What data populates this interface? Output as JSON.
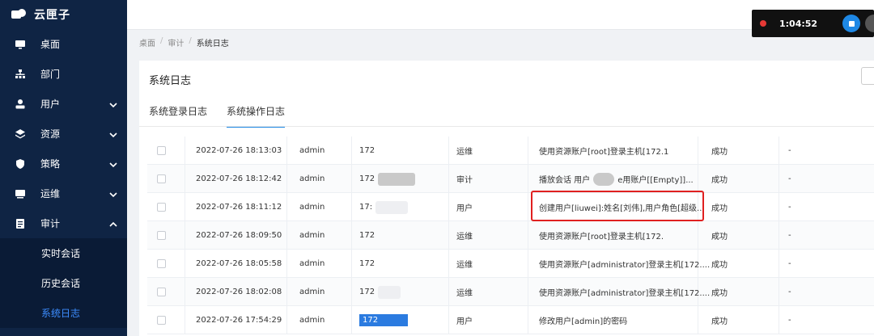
{
  "app": {
    "brand": "云匣子"
  },
  "recorder": {
    "time": "1:04:52"
  },
  "sidebar": {
    "items": [
      {
        "label": "桌面",
        "icon": "desktop-icon",
        "expandable": false
      },
      {
        "label": "部门",
        "icon": "org-icon",
        "expandable": false
      },
      {
        "label": "用户",
        "icon": "user-icon",
        "expandable": true
      },
      {
        "label": "资源",
        "icon": "resource-icon",
        "expandable": true
      },
      {
        "label": "策略",
        "icon": "shield-icon",
        "expandable": true
      },
      {
        "label": "运维",
        "icon": "ops-icon",
        "expandable": true
      },
      {
        "label": "审计",
        "icon": "audit-icon",
        "expandable": true,
        "expanded": true
      }
    ],
    "sub_items": [
      {
        "label": "实时会话"
      },
      {
        "label": "历史会话"
      },
      {
        "label": "系统日志",
        "active": true
      }
    ]
  },
  "breadcrumb": {
    "items": [
      "桌面",
      "审计",
      "系统日志"
    ],
    "sep": "/"
  },
  "card": {
    "title": "系统日志",
    "tabs": [
      {
        "label": "系统登录日志",
        "active": false
      },
      {
        "label": "系统操作日志",
        "active": true
      }
    ]
  },
  "table": {
    "rows": [
      {
        "time": "2022-07-26 18:13:03",
        "user": "admin",
        "ip": "172",
        "type": "运维",
        "desc": "使用资源账户[root]登录主机[172.1",
        "desc_tail": ".",
        "result": "成功",
        "extra": "-"
      },
      {
        "time": "2022-07-26 18:12:42",
        "user": "admin",
        "ip": "172",
        "type": "审计",
        "desc": "播放会话 用户",
        "desc_tail": "e用账户[[Empty]]...",
        "result": "成功",
        "extra": "-"
      },
      {
        "time": "2022-07-26 18:11:12",
        "user": "admin",
        "ip": "17:",
        "type": "用户",
        "desc": "创建用户[liuwei]:姓名[刘伟],用户角色[超级...",
        "desc_tail": "",
        "result": "成功",
        "extra": "-"
      },
      {
        "time": "2022-07-26 18:09:50",
        "user": "admin",
        "ip": "172",
        "type": "运维",
        "desc": "使用资源账户[root]登录主机[172.",
        "desc_tail": ".",
        "result": "成功",
        "extra": "-"
      },
      {
        "time": "2022-07-26 18:05:58",
        "user": "admin",
        "ip": "172",
        "type": "运维",
        "desc": "使用资源账户[administrator]登录主机[172....",
        "desc_tail": "",
        "result": "成功",
        "extra": "-"
      },
      {
        "time": "2022-07-26 18:02:08",
        "user": "admin",
        "ip": "172",
        "type": "运维",
        "desc": "使用资源账户[administrator]登录主机[172....",
        "desc_tail": "",
        "result": "成功",
        "extra": "-"
      },
      {
        "time": "2022-07-26 17:54:29",
        "user": "admin",
        "ip": "172",
        "type": "用户",
        "desc": "修改用户[admin]的密码",
        "desc_tail": "",
        "result": "成功",
        "extra": "-"
      }
    ]
  }
}
